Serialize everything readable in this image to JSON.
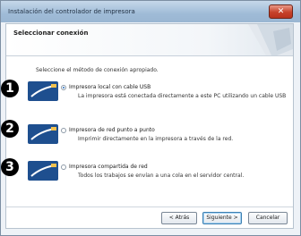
{
  "window": {
    "title": "Instalación del controlador de impresora"
  },
  "header": {
    "title": "Seleccionar conexión"
  },
  "instruction": "Seleccione el método de conexión apropiado.",
  "options": [
    {
      "label": "Impresora local con cable USB",
      "description": "La impresora está conectada directamente a este PC utilizando un cable USB",
      "selected": true,
      "badge": "1"
    },
    {
      "label": "Impresora de red punto a punto",
      "description": "Imprimir directamente en la impresora a través de la red.",
      "selected": false,
      "badge": "2"
    },
    {
      "label": "Impresora compartida de red",
      "description": "Todos los trabajos se envían a una cola en el servidor central.",
      "selected": false,
      "badge": "3"
    }
  ],
  "buttons": {
    "back": "< Atrás",
    "next": "Siguiente >",
    "cancel": "Cancelar"
  },
  "colors": {
    "radio_selected": "#2e6fbf",
    "badge": "#000000"
  }
}
